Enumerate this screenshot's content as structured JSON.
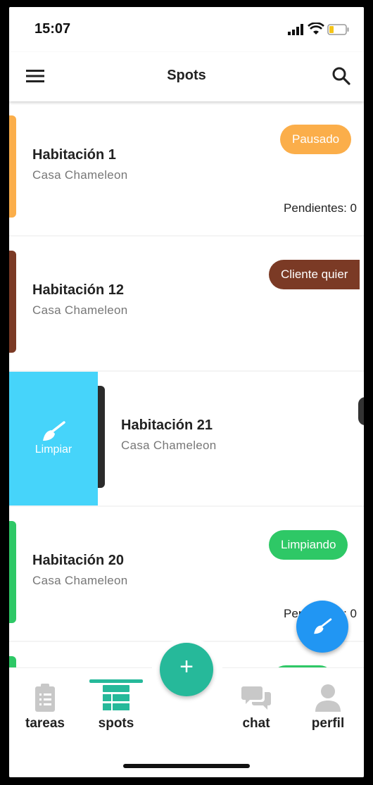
{
  "status_bar": {
    "time": "15:07"
  },
  "header": {
    "title": "Spots"
  },
  "cards": [
    {
      "name": "Habitación 1",
      "place": "Casa Chameleon",
      "status": "Pausado",
      "pending": "Pendientes: 0",
      "color": "#fbae4a"
    },
    {
      "name": "Habitación 12",
      "place": "Casa Chameleon",
      "status": "Cliente quier",
      "color": "#7b3a25"
    },
    {
      "name": "Habitación 21",
      "place": "Casa Chameleon",
      "swipe_action": "Limpiar",
      "color": "#2b2b2b",
      "swipe_color": "#46d4fa"
    },
    {
      "name": "Habitación 20",
      "place": "Casa Chameleon",
      "status": "Limpiando",
      "pending": "Pendientes: 0",
      "color": "#2ec866"
    }
  ],
  "bottom_nav": {
    "items": [
      {
        "label": "tareas",
        "icon": "clipboard-icon"
      },
      {
        "label": "spots",
        "icon": "table-icon",
        "active": true
      },
      {
        "label": "chat",
        "icon": "chat-bubbles-icon"
      },
      {
        "label": "perfil",
        "icon": "person-icon"
      }
    ],
    "add_label": "+"
  },
  "colors": {
    "accent": "#26b99a",
    "fab": "#2196f3"
  }
}
